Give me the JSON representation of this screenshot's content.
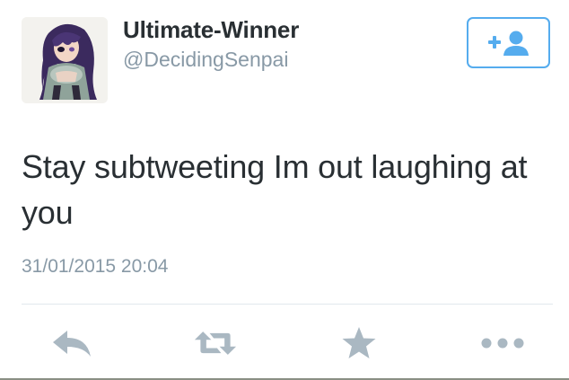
{
  "user": {
    "display_name": "Ultimate-Winner",
    "handle": "@DecidingSenpai"
  },
  "follow_button": {
    "icon": "add-user-icon"
  },
  "tweet": {
    "text": "Stay subtweeting Im out laughing at you",
    "timestamp": "31/01/2015 20:04"
  },
  "actions": [
    {
      "icon": "reply-icon"
    },
    {
      "icon": "retweet-icon"
    },
    {
      "icon": "favorite-star-icon"
    },
    {
      "icon": "more-icon"
    }
  ],
  "colors": {
    "accent": "#55acee",
    "text": "#292f33",
    "secondary_text": "#8899a6",
    "action_icons": "#aab8c2",
    "divider": "#e1e8ed"
  }
}
